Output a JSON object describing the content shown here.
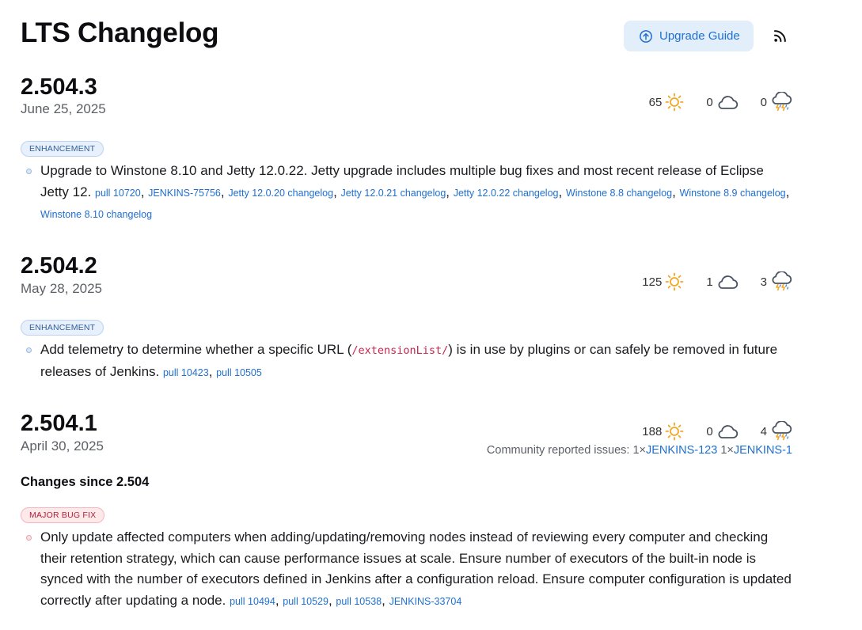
{
  "header": {
    "title": "LTS Changelog",
    "upgrade_label": "Upgrade Guide"
  },
  "releases": [
    {
      "version": "2.504.3",
      "date": "June 25, 2025",
      "ratings": {
        "sunny": "65",
        "cloudy": "0",
        "storm": "0"
      },
      "badge": "ENHANCEMENT",
      "change": {
        "text": "Upgrade to Winstone 8.10 and Jetty 12.0.22. Jetty upgrade includes multiple bug fixes and most recent release of Eclipse Jetty 12.",
        "links": [
          "pull 10720",
          "JENKINS-75756",
          "Jetty 12.0.20 changelog",
          "Jetty 12.0.21 changelog",
          "Jetty 12.0.22 changelog",
          "Winstone 8.8 changelog",
          "Winstone 8.9 changelog",
          "Winstone 8.10 changelog"
        ]
      }
    },
    {
      "version": "2.504.2",
      "date": "May 28, 2025",
      "ratings": {
        "sunny": "125",
        "cloudy": "1",
        "storm": "3"
      },
      "badge": "ENHANCEMENT",
      "change": {
        "text_before": "Add telemetry to determine whether a specific URL (",
        "code": "/extensionList/",
        "text_after": ") is in use by plugins or can safely be removed in future releases of Jenkins.",
        "links": [
          "pull 10423",
          "pull 10505"
        ]
      }
    },
    {
      "version": "2.504.1",
      "date": "April 30, 2025",
      "ratings": {
        "sunny": "188",
        "cloudy": "0",
        "storm": "4"
      },
      "community": {
        "label": "Community reported issues:",
        "issues": [
          {
            "count": "1×",
            "id": "JENKINS-123"
          },
          {
            "count": "1×",
            "id": "JENKINS-1"
          }
        ]
      },
      "subheading": "Changes since 2.504",
      "badge": "MAJOR BUG FIX",
      "change": {
        "text": "Only update affected computers when adding/updating/removing nodes instead of reviewing every computer and checking their retention strategy, which can cause performance issues at scale. Ensure number of executors of the built-in node is synced with the number of executors defined in Jenkins after a configuration reload. Ensure computer configuration is updated correctly after updating a node.",
        "links": [
          "pull 10494",
          "pull 10529",
          "pull 10538",
          "JENKINS-33704"
        ]
      }
    }
  ],
  "icons": {
    "sunny": "sun-icon",
    "cloudy": "cloud-icon",
    "storm": "thunderstorm-icon",
    "upgrade": "arrow-up-circle-icon",
    "rss": "rss-feed-icon"
  },
  "colors": {
    "link": "#1f6fd1",
    "sun": "#f5a623",
    "enhancement_badge_bg": "#e7f0fb",
    "major_bug_badge_bg": "#fde8ea"
  }
}
